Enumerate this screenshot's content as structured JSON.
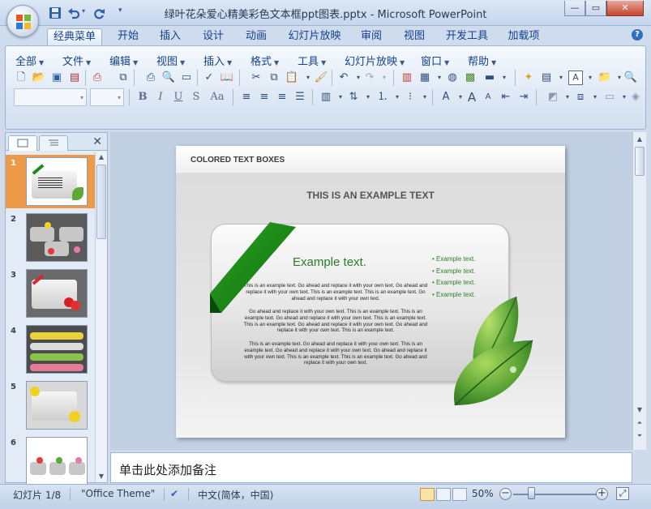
{
  "window": {
    "title": "绿叶花朵爱心精美彩色文本框ppt图表.pptx - Microsoft PowerPoint",
    "buttons": {
      "minimize": "—",
      "maximize": "▭",
      "close": "✕"
    }
  },
  "quick_access": {
    "icons": [
      "save-icon",
      "undo-icon",
      "redo-icon",
      "customize-qat-icon"
    ]
  },
  "tabs": [
    {
      "label": "经典菜单",
      "active": true
    },
    {
      "label": "开始"
    },
    {
      "label": "插入"
    },
    {
      "label": "设计"
    },
    {
      "label": "动画"
    },
    {
      "label": "幻灯片放映"
    },
    {
      "label": "审阅"
    },
    {
      "label": "视图"
    },
    {
      "label": "开发工具"
    },
    {
      "label": "加载项"
    }
  ],
  "classic_menu": [
    {
      "label": "全部"
    },
    {
      "label": "文件"
    },
    {
      "label": "编辑"
    },
    {
      "label": "视图"
    },
    {
      "label": "插入"
    },
    {
      "label": "格式"
    },
    {
      "label": "工具"
    },
    {
      "label": "幻灯片放映"
    },
    {
      "label": "窗口"
    },
    {
      "label": "帮助"
    }
  ],
  "toolbar": {
    "chevron": "▾",
    "font_size_box": "A"
  },
  "format_buttons": {
    "bold": "B",
    "italic": "I",
    "underline": "U",
    "strike": "S",
    "case": "Aa"
  },
  "left_pane": {
    "close": "✕",
    "slides": [
      {
        "num": "1",
        "active": true
      },
      {
        "num": "2"
      },
      {
        "num": "3"
      },
      {
        "num": "4"
      },
      {
        "num": "5"
      },
      {
        "num": "6"
      }
    ]
  },
  "slide": {
    "header": "COLORED TEXT BOXES",
    "subtitle": "THIS IS AN EXAMPLE TEXT",
    "card_title": "Example text.",
    "paragraphs": [
      "This is an example text. Go ahead and replace it with your own text. Go ahead and replace it with your own text. This is an example text. This is an example text. Go ahead and replace it with your own text.",
      "Go ahead and replace it with your own text. This is an example text. This is an example text. Go ahead and replace it with your own text. This is an example text. This is an example text. Go ahead and replace it with your own text. Go ahead and replace it with your own text. This is an example text.",
      "This is an example text. Go ahead and replace it with your own text. This is an example text. Go ahead and replace it with your own text. Go ahead and replace it with your own text. This is an example text. This is an example text. Go ahead and replace it with your own text."
    ],
    "bullets": [
      "Example text.",
      "Example text.",
      "Example text.",
      "Example text."
    ],
    "colors": {
      "accent_green": "#2b7d27",
      "ribbon_green": "#1d8a1a"
    }
  },
  "notes": {
    "placeholder": "单击此处添加备注"
  },
  "status": {
    "slide_counter": "幻灯片 1/8",
    "theme": "\"Office Theme\"",
    "language": "中文(简体，中国)",
    "zoom": "50%",
    "zoom_minus": "−",
    "zoom_plus": "+"
  }
}
